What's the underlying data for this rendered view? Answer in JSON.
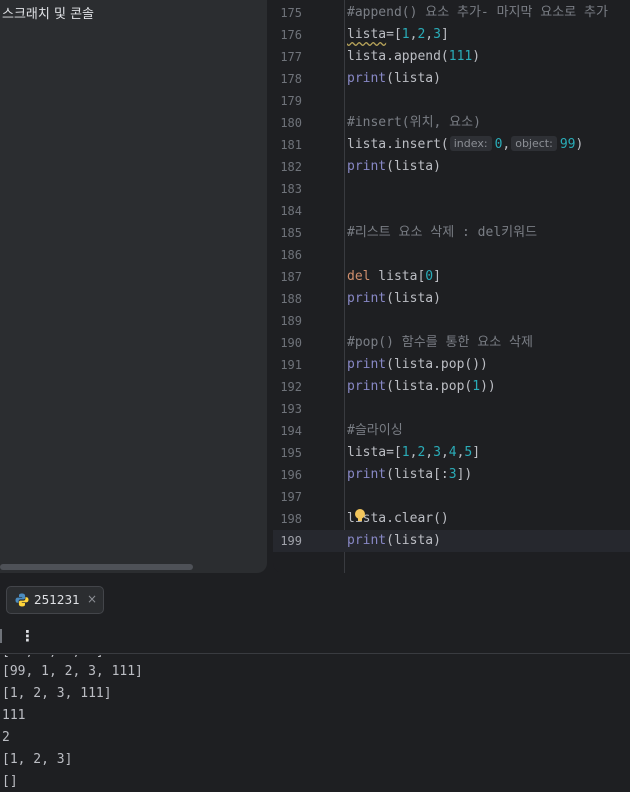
{
  "project_panel": {
    "item_label": "스크래치 및 콘솔"
  },
  "editor": {
    "line_numbers": [
      "175",
      "176",
      "177",
      "178",
      "179",
      "180",
      "181",
      "182",
      "183",
      "184",
      "185",
      "186",
      "187",
      "188",
      "189",
      "190",
      "191",
      "192",
      "193",
      "194",
      "195",
      "196",
      "197",
      "198",
      "199"
    ],
    "current_line": "199",
    "code": {
      "l175": "#append() 요소 추가- 마지막 요소로 추가",
      "l176_a": "lista",
      "l176_b": "=[",
      "l176_c": "1",
      "l176_d": ",",
      "l176_e": "2",
      "l176_f": ",",
      "l176_g": "3",
      "l176_h": "]",
      "l177_a": "lista.append(",
      "l177_b": "111",
      "l177_c": ")",
      "l178_a": "print",
      "l178_b": "(lista)",
      "l180": "#insert(위치, 요소)",
      "l181_a": "lista.insert(",
      "l181_hint1": "index:",
      "l181_v1": "0",
      "l181_comma": ",",
      "l181_hint2": "object:",
      "l181_v2": "99",
      "l181_close": ")",
      "l182_a": "print",
      "l182_b": "(lista)",
      "l185": "#리스트 요소 삭제 : del키워드",
      "l187_a": "del",
      "l187_b": " lista[",
      "l187_c": "0",
      "l187_d": "]",
      "l188_a": "print",
      "l188_b": "(lista)",
      "l190": "#pop() 함수를 통한 요소 삭제",
      "l191_a": "print",
      "l191_b": "(lista.pop())",
      "l192_a": "print",
      "l192_b": "(lista.pop(",
      "l192_c": "1",
      "l192_d": "))",
      "l194": "#슬라이싱",
      "l195_a": "lista=[",
      "l195_n1": "1",
      "l195_c1": ",",
      "l195_n2": "2",
      "l195_c2": ",",
      "l195_n3": "3",
      "l195_c3": ",",
      "l195_n4": "4",
      "l195_c4": ",",
      "l195_n5": "5",
      "l195_b": "]",
      "l196_a": "print",
      "l196_b": "(lista[:",
      "l196_c": "3",
      "l196_d": "])",
      "l198": "lista.clear()",
      "l199_a": "print",
      "l199_b": "(lista)"
    }
  },
  "run_panel": {
    "tab_label": "251231",
    "tab_close": "×",
    "menu_icon": "⋮",
    "output": [
      "[99, 1, 2, 3, 111]",
      "[1, 2, 3, 111]",
      "111",
      "2",
      "[1, 2, 3]",
      "[]"
    ]
  },
  "colors": {
    "background": "#1e1f22",
    "panel": "#2b2d30",
    "comment": "#7a7e85",
    "keyword": "#cf8e6d",
    "builtin": "#8888c6",
    "number": "#2aacb8",
    "text": "#bcbec4"
  },
  "icons": [
    "python-icon",
    "close-icon",
    "more-options-icon",
    "lightbulb-icon"
  ]
}
